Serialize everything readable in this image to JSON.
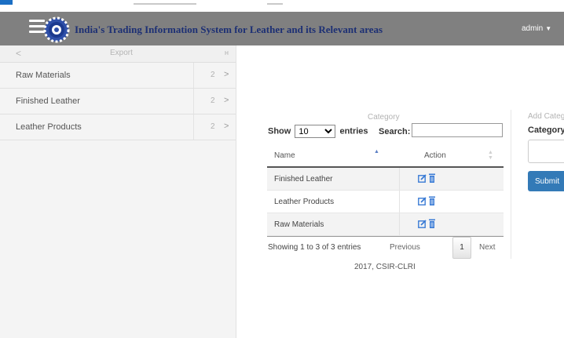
{
  "header": {
    "title": "India's Trading Information System for Leather and its Relevant areas",
    "user": "admin",
    "menu_icon": "hamburger-menu-icon",
    "logo_icon": "csir-gear-logo-icon",
    "bg_color": "#808080",
    "title_color": "#1c2f74"
  },
  "sidebar": {
    "header": {
      "back_symbol": "<",
      "title": "Export",
      "collapse_symbol": "ʜ"
    },
    "items": [
      {
        "label": "Raw Materials",
        "count": "2",
        "chevron": ">"
      },
      {
        "label": "Finished Leather",
        "count": "2",
        "chevron": ">"
      },
      {
        "label": "Leather Products",
        "count": "2",
        "chevron": ">"
      }
    ]
  },
  "main": {
    "caption": "Category",
    "length": {
      "show": "Show",
      "entries": "entries",
      "selected": "10"
    },
    "search": {
      "label": "Search:",
      "value": ""
    },
    "table": {
      "columns": [
        "Name",
        "Action"
      ],
      "rows": [
        {
          "name": "Finished Leather"
        },
        {
          "name": "Leather Products"
        },
        {
          "name": "Raw Materials"
        }
      ]
    },
    "info": "Showing 1 to 3 of 3 entries",
    "pagination": {
      "previous": "Previous",
      "page": "1",
      "next": "Next"
    },
    "footer": "2017, CSIR-CLRI"
  },
  "add_panel": {
    "caption": "Add Categ",
    "field_label": "Category*",
    "input_value": "",
    "submit_label": "Submit",
    "accent_color": "#337ab7"
  }
}
